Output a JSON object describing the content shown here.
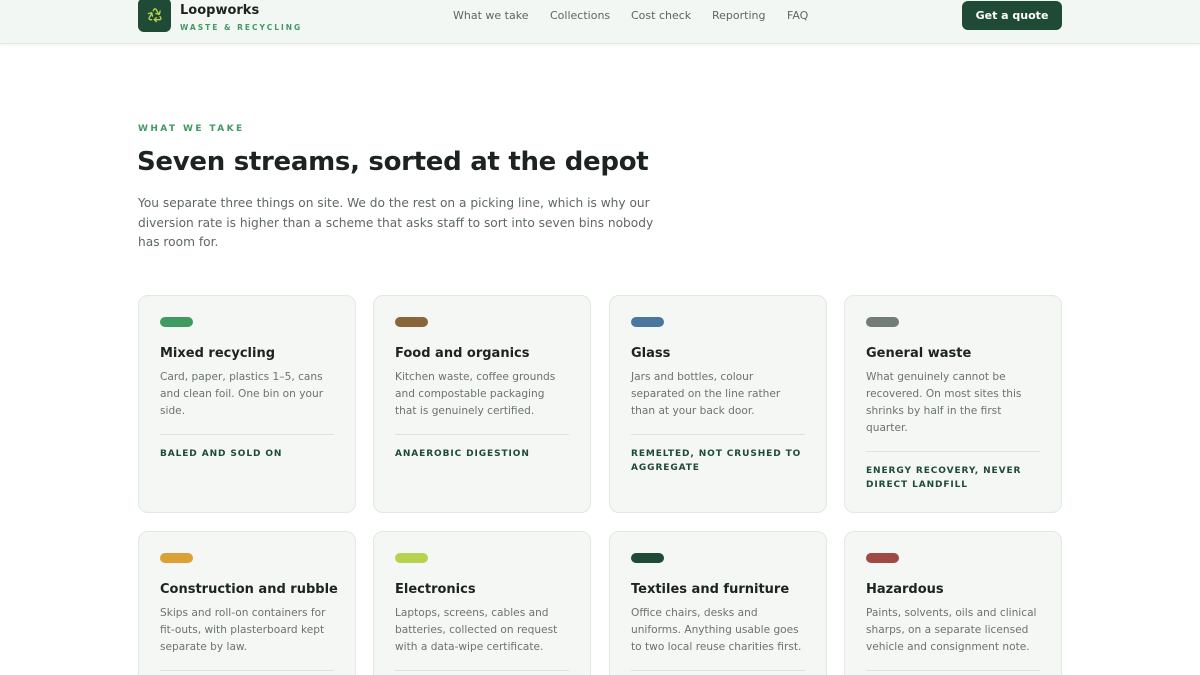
{
  "brand": {
    "name": "Loopworks",
    "tagline": "WASTE & RECYCLING",
    "logo_icon": "recycle-icon",
    "logo_color": "#1f4a35"
  },
  "nav": {
    "items": [
      {
        "label": "What we take"
      },
      {
        "label": "Collections"
      },
      {
        "label": "Cost check"
      },
      {
        "label": "Reporting"
      },
      {
        "label": "FAQ"
      }
    ],
    "cta_label": "Get a quote"
  },
  "section": {
    "eyebrow": "WHAT WE TAKE",
    "title": "Seven streams, sorted at the depot",
    "lede": "You separate three things on site. We do the rest on a picking line, which is why our diversion rate is higher than a scheme that asks staff to sort into seven bins nobody has room for."
  },
  "streams": [
    {
      "title": "Mixed recycling",
      "description": "Card, paper, plastics 1–5, cans and clean foil. One bin on your side.",
      "outcome": "Baled and sold on",
      "color": "#3f9a63"
    },
    {
      "title": "Food and organics",
      "description": "Kitchen waste, coffee grounds and compostable packaging that is genuinely certified.",
      "outcome": "Anaerobic digestion",
      "color": "#8a6537"
    },
    {
      "title": "Glass",
      "description": "Jars and bottles, colour separated on the line rather than at your back door.",
      "outcome": "Remelted, not crushed to aggregate",
      "color": "#4a76a0"
    },
    {
      "title": "General waste",
      "description": "What genuinely cannot be recovered. On most sites this shrinks by half in the first quarter.",
      "outcome": "Energy recovery, never direct landfill",
      "color": "#717d76"
    },
    {
      "title": "Construction and rubble",
      "description": "Skips and roll-on containers for fit-outs, with plasterboard kept separate by law.",
      "outcome": "",
      "color": "#dba036"
    },
    {
      "title": "Electronics",
      "description": "Laptops, screens, cables and batteries, collected on request with a data-wipe certificate.",
      "outcome": "",
      "color": "#b6d350"
    },
    {
      "title": "Textiles and furniture",
      "description": "Office chairs, desks and uniforms. Anything usable goes to two local reuse charities first.",
      "outcome": "",
      "color": "#1f4a35"
    },
    {
      "title": "Hazardous",
      "description": "Paints, solvents, oils and clinical sharps, on a separate licensed vehicle and consignment note.",
      "outcome": "",
      "color": "#a04a45"
    }
  ]
}
